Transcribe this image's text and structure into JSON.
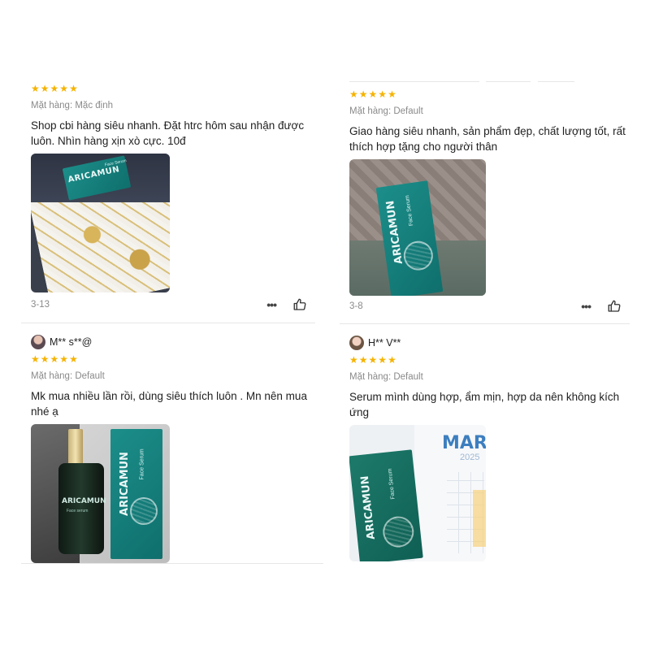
{
  "reviews": [
    {
      "rating": 5,
      "variant": "Mặt hàng: Mặc định",
      "text": "Shop cbi hàng siêu nhanh. Đặt htrc hôm sau nhận được luôn. Nhìn hàng xịn xò cực. 10đ",
      "date": "3-13",
      "photo_product": {
        "brand": "ARICAMUN",
        "label": "Face Serum"
      }
    },
    {
      "rating": 5,
      "variant": "Mặt hàng: Default",
      "text": "Giao hàng siêu nhanh, sản phẩm đẹp, chất lượng tốt, rất thích hợp tặng cho người thân",
      "date": "3-8",
      "photo_product": {
        "brand": "ARICAMUN",
        "label": "Face Serum"
      }
    },
    {
      "username": "M** s**@",
      "rating": 5,
      "variant": "Mặt hàng: Default",
      "text": "Mk mua nhiều lần rồi, dùng siêu thích luôn . Mn nên mua nhé ạ",
      "photo_product": {
        "brand": "ARICAMUN",
        "label": "Face Serum",
        "bottle_label": "Face serum"
      }
    },
    {
      "username": "H** V**",
      "rating": 5,
      "variant": "Mặt hàng: Default",
      "text": "Serum mình dùng hợp, ẩm mịn, hợp da nên không kích ứng",
      "photo_product": {
        "brand": "ARICAMUN",
        "label": "Face Serum",
        "calendar_month": "MAR",
        "calendar_year": "2025"
      }
    }
  ],
  "colors": {
    "star": "#f5b301",
    "muted": "#8a8a8a",
    "product_teal": "#12807c"
  },
  "icons": {
    "more": "more-dots-icon",
    "like": "thumbs-up-icon",
    "star": "star-icon"
  }
}
